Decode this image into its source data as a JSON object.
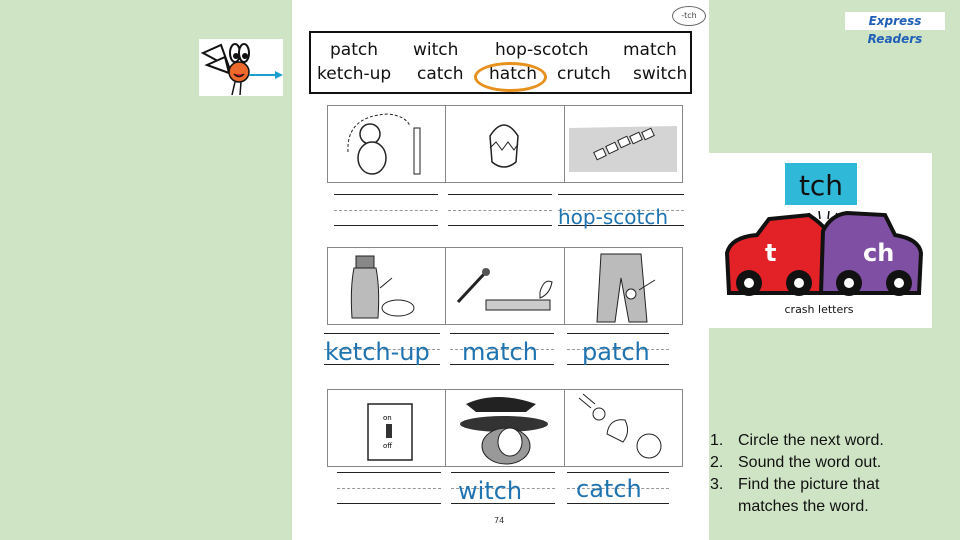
{
  "mascot": {
    "icon": "fly-mascot-icon"
  },
  "brand": {
    "label": "Express Readers"
  },
  "worksheet": {
    "tag": "-tch",
    "word_bank": {
      "row1": [
        "patch",
        "witch",
        "hop-scotch",
        "match"
      ],
      "row2": [
        "ketch-up",
        "catch",
        "hatch",
        "crutch",
        "switch"
      ],
      "circled": "hatch"
    },
    "rows": [
      {
        "pictures": [
          "pig-with-crutch-picture",
          "hatching-chick-picture",
          "hopscotch-picture"
        ],
        "answers": [
          "",
          "",
          "hop-scotch"
        ]
      },
      {
        "pictures": [
          "ketchup-bottle-picture",
          "match-picture",
          "patched-pants-picture"
        ],
        "answers": [
          "ketch-up",
          "match",
          "patch"
        ]
      },
      {
        "pictures": [
          "light-switch-picture",
          "witch-picture",
          "monkey-catch-picture"
        ],
        "answers": [
          "",
          "witch",
          "catch"
        ]
      }
    ],
    "page_number": "74"
  },
  "crash_letters": {
    "blend": "tch",
    "left_car": "t",
    "right_car": "ch",
    "caption": "crash letters",
    "colors": {
      "blend_bg": "#2fb8d8",
      "left_car": "#e32228",
      "right_car": "#7e4fa3"
    }
  },
  "instructions": [
    {
      "num": "1.",
      "text": "Circle the next word."
    },
    {
      "num": "2.",
      "text": "Sound the word out."
    },
    {
      "num": "3.",
      "text": "Find the picture that"
    },
    {
      "num": "",
      "text": "matches the word."
    }
  ]
}
